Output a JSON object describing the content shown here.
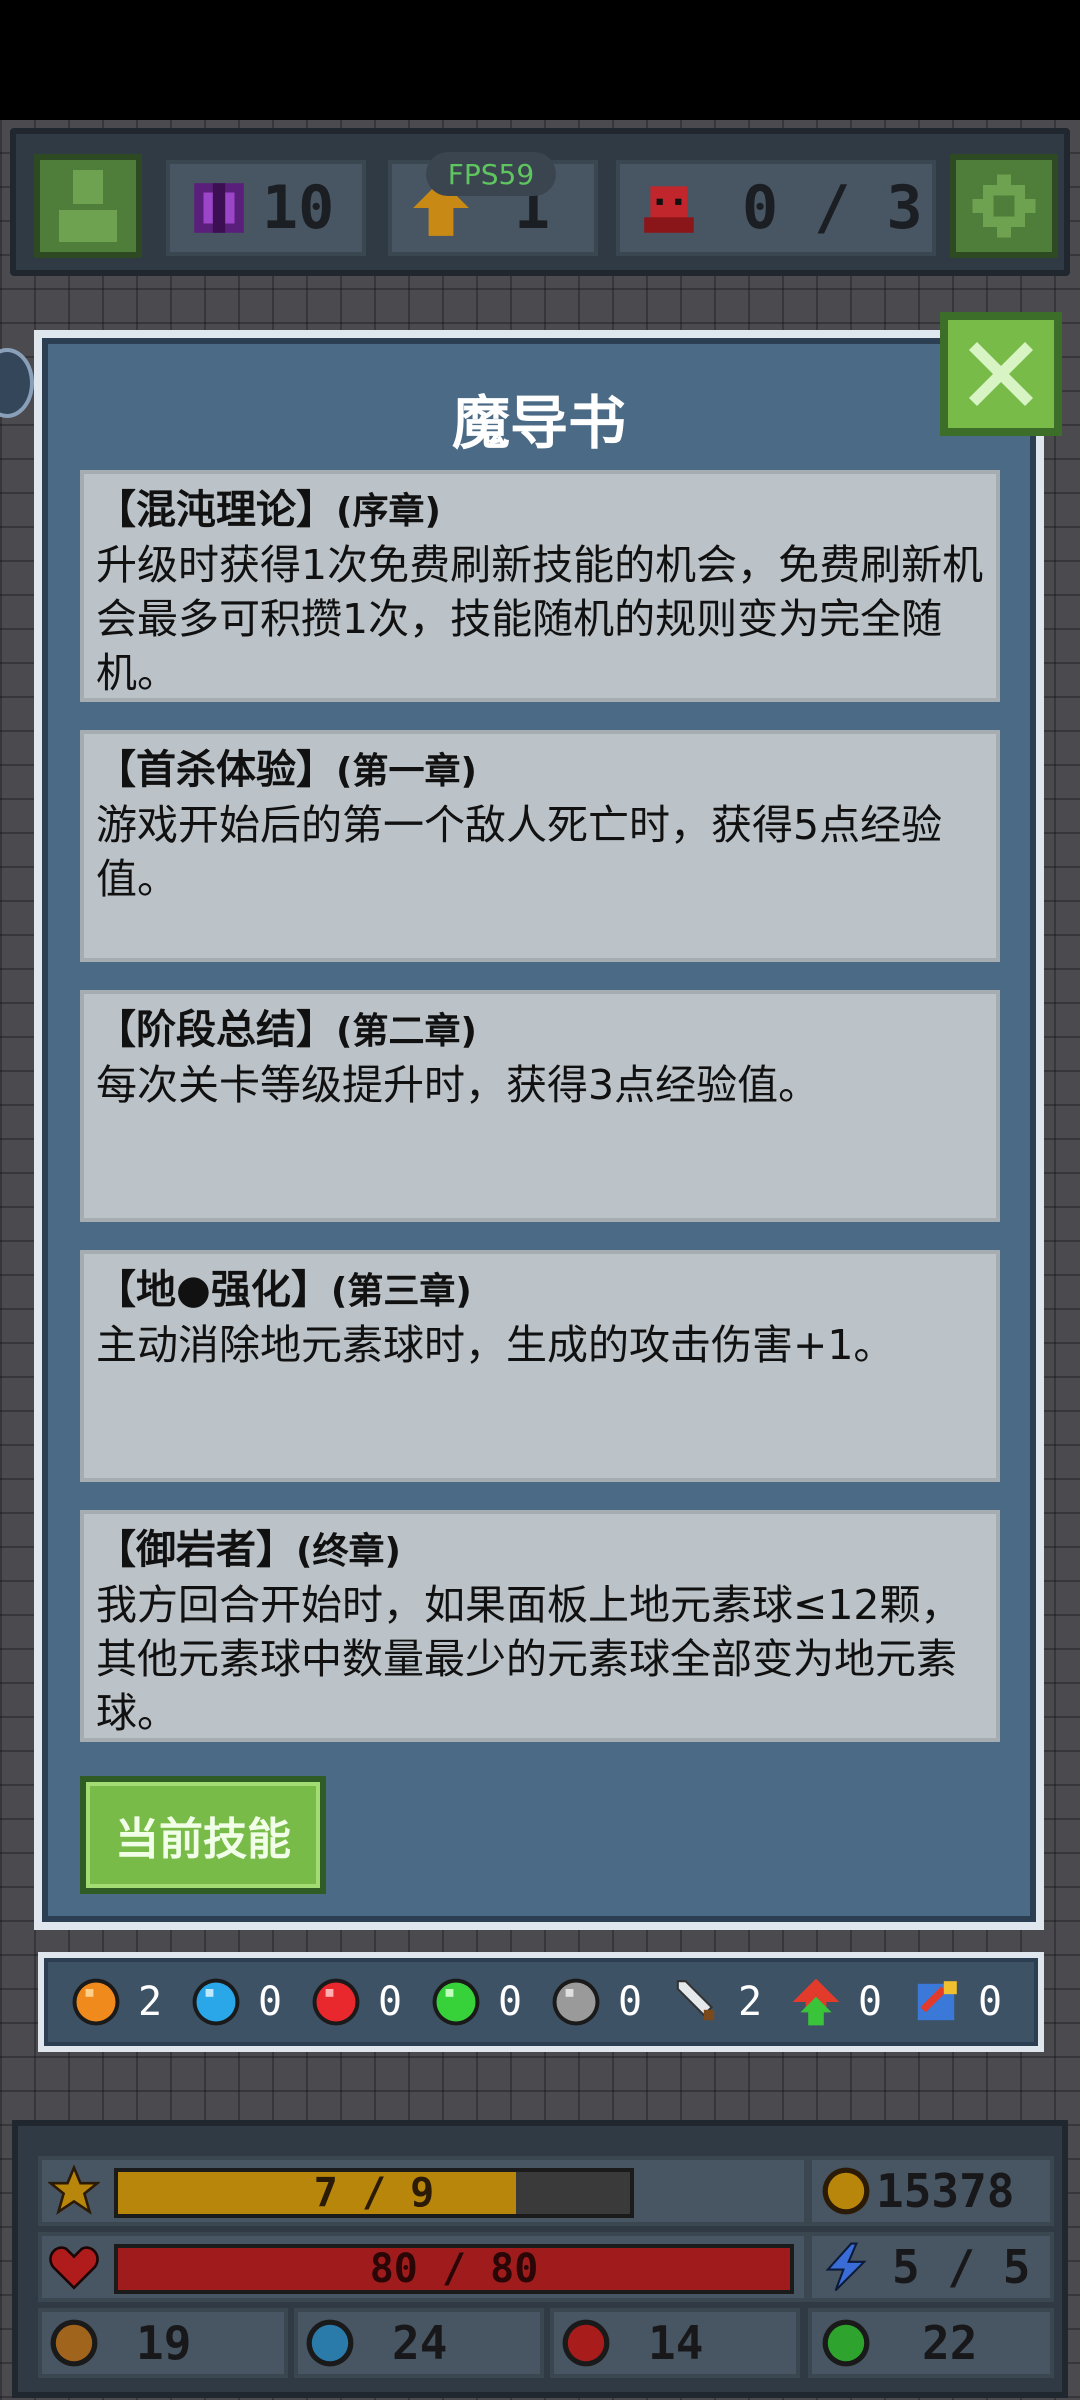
{
  "topbar": {
    "gems": "10",
    "level": "1",
    "fps": "FPS59",
    "enemies": "0 / 3"
  },
  "panel": {
    "title": "魔导书",
    "cards": [
      {
        "name": "【混沌理论】",
        "chapter": "(序章)",
        "desc": "升级时获得1次免费刷新技能的机会，免费刷新机会最多可积攒1次，技能随机的规则变为完全随机。"
      },
      {
        "name": "【首杀体验】",
        "chapter": "(第一章)",
        "desc": "游戏开始后的第一个敌人死亡时，获得5点经验值。"
      },
      {
        "name": "【阶段总结】",
        "chapter": "(第二章)",
        "desc": "每次关卡等级提升时，获得3点经验值。"
      },
      {
        "name": "【地●强化】",
        "chapter": "(第三章)",
        "desc": "主动消除地元素球时，生成的攻击伤害+1。"
      },
      {
        "name": "【御岩者】",
        "chapter": "(终章)",
        "desc": "我方回合开始时，如果面板上地元素球≤12颗，其他元素球中数量最少的元素球全部变为地元素球。"
      }
    ],
    "current_skill_button": "当前技能"
  },
  "orbs": [
    {
      "icon": "orange-orb-icon",
      "color": "#f08a1c",
      "count": "2"
    },
    {
      "icon": "blue-orb-icon",
      "color": "#29a7e8",
      "count": "0"
    },
    {
      "icon": "red-orb-icon",
      "color": "#e8282c",
      "count": "0"
    },
    {
      "icon": "green-orb-icon",
      "color": "#37d13a",
      "count": "0"
    },
    {
      "icon": "gray-orb-icon",
      "color": "#9a9a9a",
      "count": "0"
    },
    {
      "icon": "sword-icon",
      "color": "#cfd3d6",
      "count": "2"
    },
    {
      "icon": "upgrade-arrow-icon",
      "color": "#e23b2b",
      "count": "0"
    },
    {
      "icon": "swap-icon",
      "color": "#3a79d8",
      "count": "0"
    }
  ],
  "stats": {
    "exp": {
      "label": "7 / 9",
      "fraction": 0.7778,
      "color": "#b8860b"
    },
    "hp": {
      "label": "80 / 80",
      "fraction": 1.0,
      "color": "#a01c1c"
    },
    "gold": "15378",
    "energy": "5 / 5",
    "earth": "19",
    "water": "24",
    "fire": "14",
    "wood": "22"
  }
}
